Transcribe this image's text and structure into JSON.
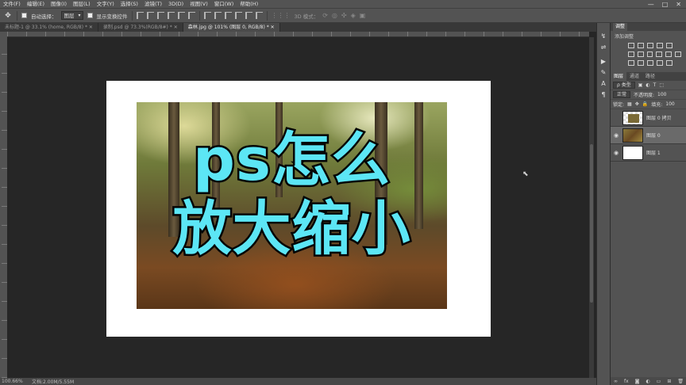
{
  "menubar": {
    "items": [
      "文件(F)",
      "编辑(E)",
      "图像(I)",
      "图层(L)",
      "文字(Y)",
      "选择(S)",
      "滤镜(T)",
      "3D(D)",
      "视图(V)",
      "窗口(W)",
      "帮助(H)"
    ],
    "window_controls": [
      "—",
      "□",
      "✕"
    ]
  },
  "options": {
    "auto_select_label": "自动选择：",
    "layer_select": "图层",
    "show_transform_label": "显示变换控件",
    "mode_3d_label": "3D 模式："
  },
  "tabs": [
    {
      "label": "未标题-1 @ 33.1% (home, RGB/8) *"
    },
    {
      "label": "录制.psd @ 73.3%(RGB/8#) *"
    },
    {
      "label": "森林.jpg @ 101% (图层 0, RGB/8) *"
    }
  ],
  "canvas": {
    "headline_line1": "ps怎么",
    "headline_line2": "放大缩小"
  },
  "status": {
    "zoom": "100.66%",
    "doc_info": "文档:2.00M/5.55M"
  },
  "panel": {
    "adjust_tab": "调整",
    "add_adjustment": "添加调整",
    "layers_tabs": [
      "图层",
      "通道",
      "路径"
    ],
    "filter_kind": "ρ 类型",
    "blend_mode": "正常",
    "opacity_label": "不透明度:",
    "opacity_value": "100",
    "lock_label": "锁定:",
    "fill_label": "填充:",
    "fill_value": "100",
    "layers": [
      {
        "name": "图层 0 拷贝",
        "visible": false,
        "thumb": "copy"
      },
      {
        "name": "图层 0",
        "visible": true,
        "thumb": "photo",
        "selected": true
      },
      {
        "name": "图层 1",
        "visible": true,
        "thumb": "white"
      }
    ]
  }
}
